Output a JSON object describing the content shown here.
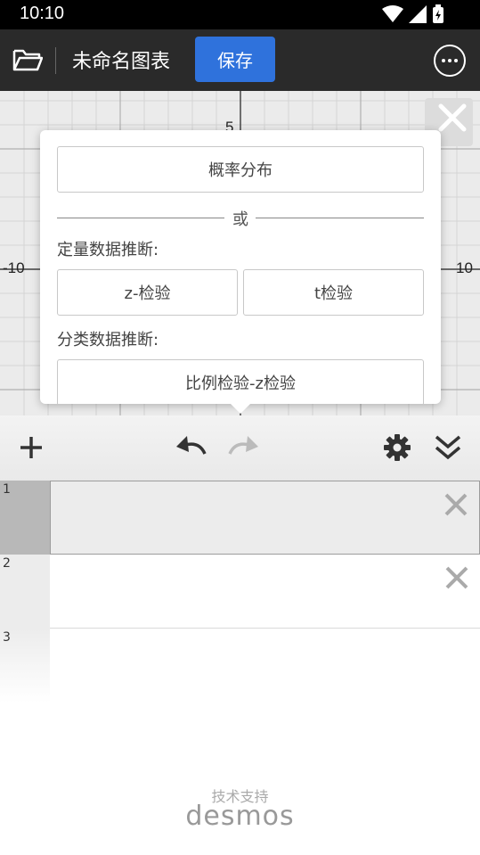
{
  "status_bar": {
    "time": "10:10"
  },
  "app_bar": {
    "title": "未命名图表",
    "save_label": "保存"
  },
  "graph": {
    "x_labels": [
      "-10",
      "10"
    ],
    "y_label": "5"
  },
  "popup": {
    "probability_label": "概率分布",
    "or_label": "或",
    "quant_heading": "定量数据推断:",
    "z_test_label": "z-检验",
    "t_test_label": "t检验",
    "cat_heading": "分类数据推断:",
    "prop_test_label": "比例检验-z检验"
  },
  "list": {
    "rows": [
      {
        "number": "1"
      },
      {
        "number": "2"
      },
      {
        "number": "3"
      }
    ]
  },
  "footer": {
    "powered_by": "技术支持",
    "logo": "desmos"
  },
  "colors": {
    "accent": "#2f72dc",
    "app_bar": "#2a2a2a"
  }
}
